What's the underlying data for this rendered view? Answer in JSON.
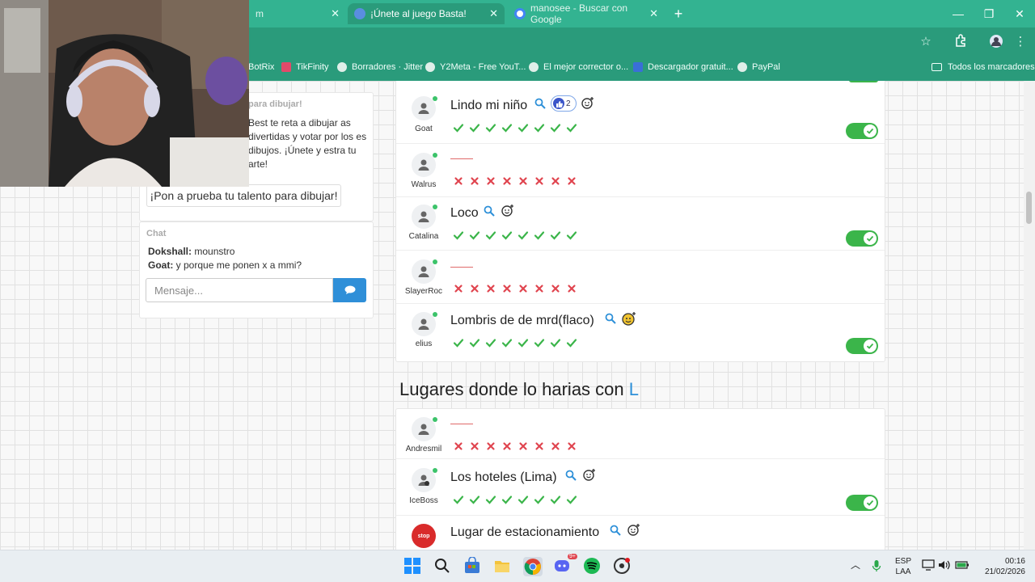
{
  "tabs": [
    {
      "label": "m",
      "active": false
    },
    {
      "label": "¡Únete al juego Basta!",
      "active": true
    },
    {
      "label": "manosee - Buscar con Google",
      "active": false
    }
  ],
  "new_tab_label": "+",
  "window_controls": {
    "minimize": "—",
    "restore": "❐",
    "close": "✕"
  },
  "bookmarks": [
    {
      "label": "BotRix",
      "icon": "botrix-icon"
    },
    {
      "label": "TikFinity",
      "icon": "tikfinity-icon"
    },
    {
      "label": "Borradores · Jitter",
      "icon": "globe-icon"
    },
    {
      "label": "Y2Meta - Free YouT...",
      "icon": "globe-icon"
    },
    {
      "label": "El mejor corrector o...",
      "icon": "globe-icon"
    },
    {
      "label": "Descargador gratuit...",
      "icon": "infinity-icon"
    },
    {
      "label": "PayPal",
      "icon": "globe-icon"
    }
  ],
  "all_bookmarks_label": "Todos los marcadores",
  "sidebar": {
    "draw_title": "para dibujar!",
    "draw_description": "Best te reta a dibujar as divertidas y votar por los es dibujos. ¡Únete y estra tu arte!",
    "draw_button": "¡Pon a prueba tu talento para dibujar!",
    "chat_label": "Chat",
    "chat_messages": [
      {
        "user": "Dokshall:",
        "text": " mounstro"
      },
      {
        "user": "Goat:",
        "text": " y porque me ponen x a mmi?"
      }
    ],
    "chat_placeholder": "Mensaje..."
  },
  "category1": {
    "answers": [
      {
        "player": "Goat",
        "answer": "Lindo mi niño",
        "likes": "2",
        "valid": true
      },
      {
        "player": "Walrus",
        "answer": "",
        "valid": false
      },
      {
        "player": "Catalina",
        "answer": "Loco",
        "valid": true
      },
      {
        "player": "SlayerRoc",
        "answer": "",
        "valid": false
      },
      {
        "player": "elius",
        "answer": "Lombris de de mrd(flaco)",
        "valid": true
      }
    ]
  },
  "category2": {
    "heading": "Lugares donde lo harias con",
    "letter": "L",
    "answers": [
      {
        "player": "Andresmil",
        "answer": "",
        "valid": false
      },
      {
        "player": "IceBoss",
        "answer": "Los hoteles (Lima)",
        "valid": true
      },
      {
        "player": "",
        "answer": "Lugar de estacionamiento",
        "valid": true
      }
    ]
  },
  "taskbar": {
    "lang_top": "ESP",
    "lang_bottom": "LAA",
    "time": "00:16",
    "date": "21/02/2026",
    "discord_badge": "9+"
  },
  "colors": {
    "tab_bar": "#33b391",
    "toolbar": "#2a9b7b",
    "accent_blue": "#2e90d8",
    "valid_green": "#3bb54a",
    "invalid_red": "#e0454f"
  }
}
